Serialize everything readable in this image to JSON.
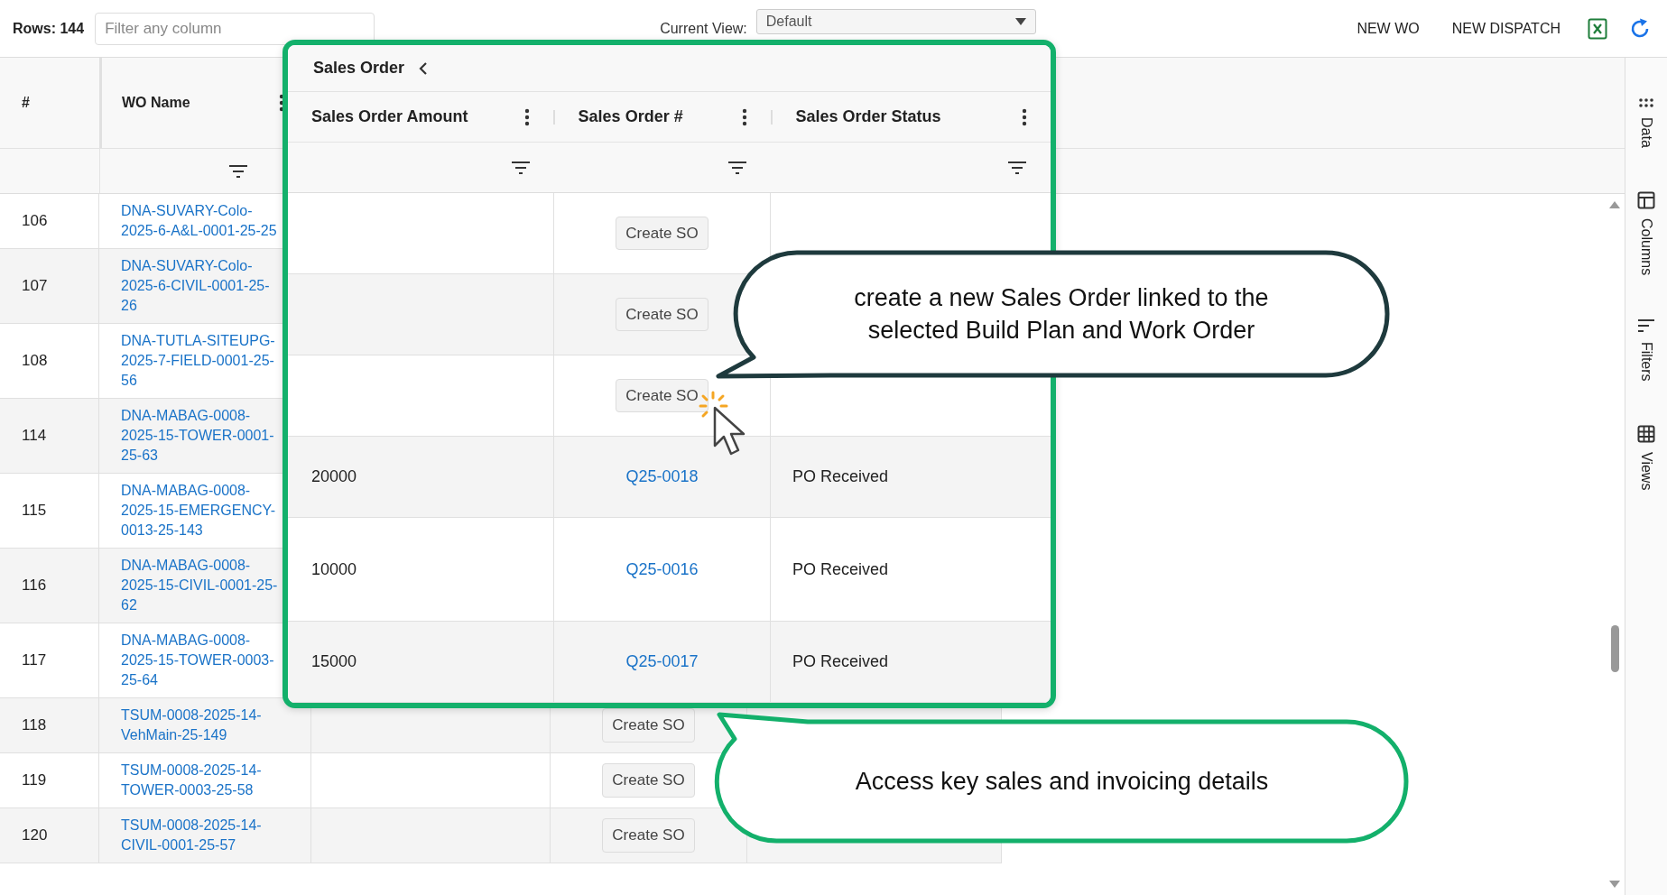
{
  "toolbar": {
    "rows_count": "Rows: 144",
    "filter": {
      "placeholder": "Filter any column"
    },
    "view_label": "Current View:",
    "view_value": "Default",
    "actions": [
      "NEW WO",
      "NEW DISPATCH"
    ]
  },
  "grid": {
    "columns": [
      "#",
      "WO Name"
    ],
    "rows": [
      {
        "number": "106",
        "wo_name": "DNA-SUVARY-Colo-2025-6-A&L-0001-25-25"
      },
      {
        "number": "107",
        "wo_name": "DNA-SUVARY-Colo-2025-6-CIVIL-0001-25-26"
      },
      {
        "number": "108",
        "wo_name": "DNA-TUTLA-SITEUPG-2025-7-FIELD-0001-25-56"
      },
      {
        "number": "114",
        "wo_name": "DNA-MABAG-0008-2025-15-TOWER-0001-25-63"
      },
      {
        "number": "115",
        "wo_name": "DNA-MABAG-0008-2025-15-EMERGENCY-0013-25-143"
      },
      {
        "number": "116",
        "wo_name": "DNA-MABAG-0008-2025-15-CIVIL-0001-25-62"
      },
      {
        "number": "117",
        "wo_name": "DNA-MABAG-0008-2025-15-TOWER-0003-25-64"
      },
      {
        "number": "118",
        "wo_name": "TSUM-0008-2025-14-VehMain-25-149",
        "action": "Create SO"
      },
      {
        "number": "119",
        "wo_name": "TSUM-0008-2025-14-TOWER-0003-25-58",
        "action": "Create SO"
      },
      {
        "number": "120",
        "wo_name": "TSUM-0008-2025-14-CIVIL-0001-25-57",
        "action": "Create SO"
      }
    ]
  },
  "sales_order_panel": {
    "group_title": "Sales Order",
    "columns": [
      "Sales Order Amount",
      "Sales Order #",
      "Sales Order Status"
    ],
    "rows": [
      {
        "action": "Create SO"
      },
      {
        "action": "Create SO"
      },
      {
        "action": "Create SO"
      },
      {
        "amount": "20000",
        "so_number": "Q25-0018",
        "status": "PO Received"
      },
      {
        "amount": "10000",
        "so_number": "Q25-0016",
        "status": "PO Received"
      },
      {
        "amount": "15000",
        "so_number": "Q25-0017",
        "status": "PO Received"
      }
    ]
  },
  "side_tabs": [
    {
      "label": "Data",
      "kind": "data"
    },
    {
      "label": "Columns",
      "kind": "columns"
    },
    {
      "label": "Filters",
      "kind": "filters"
    },
    {
      "label": "Views",
      "kind": "views"
    }
  ],
  "callouts": [
    {
      "text": "create a new Sales Order linked to the selected Build Plan and Work Order",
      "color": "#1e3a3d"
    },
    {
      "text": "Access key sales and invoicing details",
      "color": "#13b06b"
    }
  ]
}
